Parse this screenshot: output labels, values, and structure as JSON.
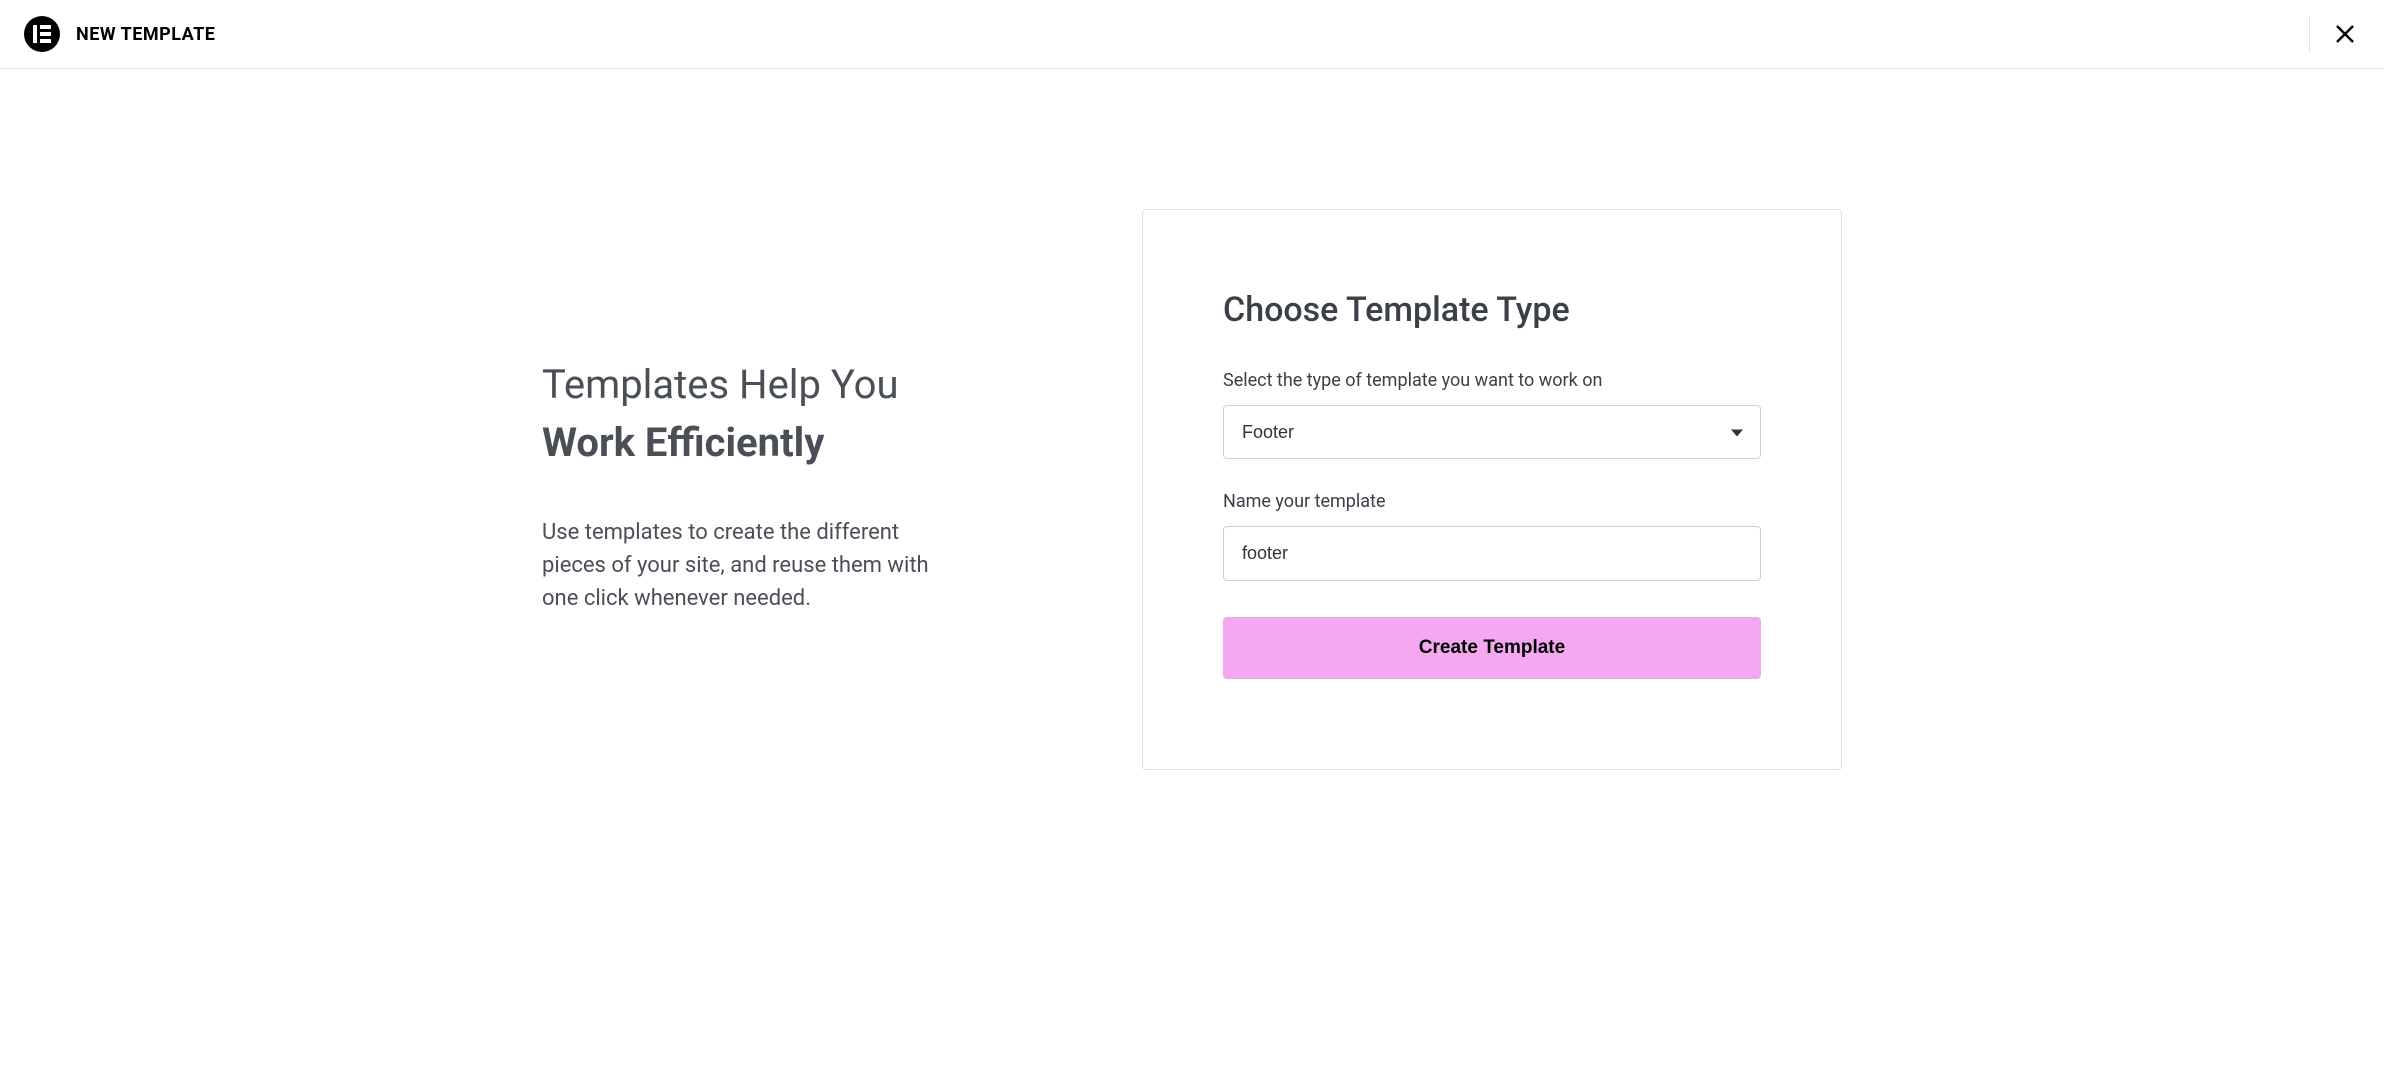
{
  "header": {
    "title": "NEW TEMPLATE"
  },
  "intro": {
    "heading_light": "Templates Help You",
    "heading_bold": "Work Efficiently",
    "description": "Use templates to create the different pieces of your site, and reuse them with one click whenever needed."
  },
  "form": {
    "title": "Choose Template Type",
    "type_label": "Select the type of template you want to work on",
    "type_value": "Footer",
    "name_label": "Name your template",
    "name_value": "footer",
    "submit_label": "Create Template"
  }
}
